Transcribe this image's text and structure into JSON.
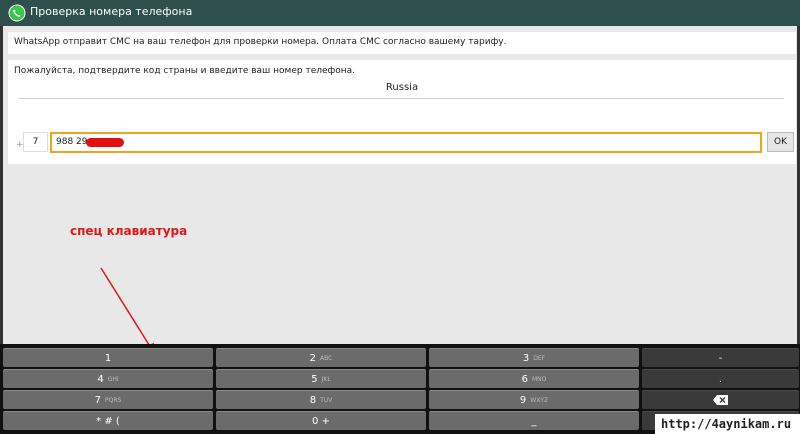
{
  "titlebar": {
    "icon": "whatsapp-icon",
    "title": "Проверка номера телефона",
    "bg_color": "#2f4e4e"
  },
  "info": {
    "text": "WhatsApp отправит СМС на ваш телефон для проверки номера. Оплата СМС согласно вашему тарифу."
  },
  "form": {
    "prompt": "Пожалуйста, подтвердите код страны и введите ваш номер телефона.",
    "country": "Russia",
    "plus_prefix": "+",
    "country_code": "7",
    "phone_value": "988 29",
    "ok_label": "OK",
    "focus_color": "#f0a41e"
  },
  "annotation": {
    "text": "спец клавиатура",
    "color": "#e01818"
  },
  "keyboard": {
    "rows": [
      [
        {
          "main": "1",
          "sub": ""
        },
        {
          "main": "2",
          "sub": "ABC"
        },
        {
          "main": "3",
          "sub": "DEF"
        },
        {
          "main": "-",
          "sub": ""
        }
      ],
      [
        {
          "main": "4",
          "sub": "GHI"
        },
        {
          "main": "5",
          "sub": "JKL"
        },
        {
          "main": "6",
          "sub": "MNO"
        },
        {
          "main": ".",
          "sub": ""
        }
      ],
      [
        {
          "main": "7",
          "sub": "PQRS"
        },
        {
          "main": "8",
          "sub": "TUV"
        },
        {
          "main": "9",
          "sub": "WXYZ"
        },
        {
          "main": "",
          "sub": "",
          "icon": "backspace-icon"
        }
      ],
      [
        {
          "main": "* # (",
          "sub": ""
        },
        {
          "main": "0 +",
          "sub": ""
        },
        {
          "main": "_",
          "sub": ""
        },
        {
          "main": "",
          "sub": ""
        }
      ]
    ]
  },
  "watermark": {
    "text": "http://4aynikam.ru"
  }
}
